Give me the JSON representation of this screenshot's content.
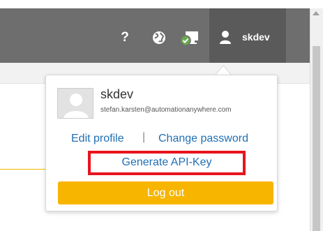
{
  "header": {
    "help_glyph": "?",
    "username": "skdev",
    "icons": [
      "help-icon",
      "globe-icon",
      "monitor-status-icon",
      "user-icon"
    ],
    "colors": {
      "bar": "#6e6e6e",
      "active_user_area": "#5a5a5a",
      "status_ok": "#6aa84f"
    }
  },
  "profile_menu": {
    "name": "skdev",
    "email": "stefan.karsten@automationanywhere.com",
    "edit_profile_label": "Edit profile",
    "separator": "|",
    "change_password_label": "Change password",
    "generate_api_key_label": "Generate API-Key",
    "logout_label": "Log out",
    "colors": {
      "link": "#1f6fb4",
      "logout": "#f7b500",
      "highlight_box": "#e8141d"
    }
  }
}
